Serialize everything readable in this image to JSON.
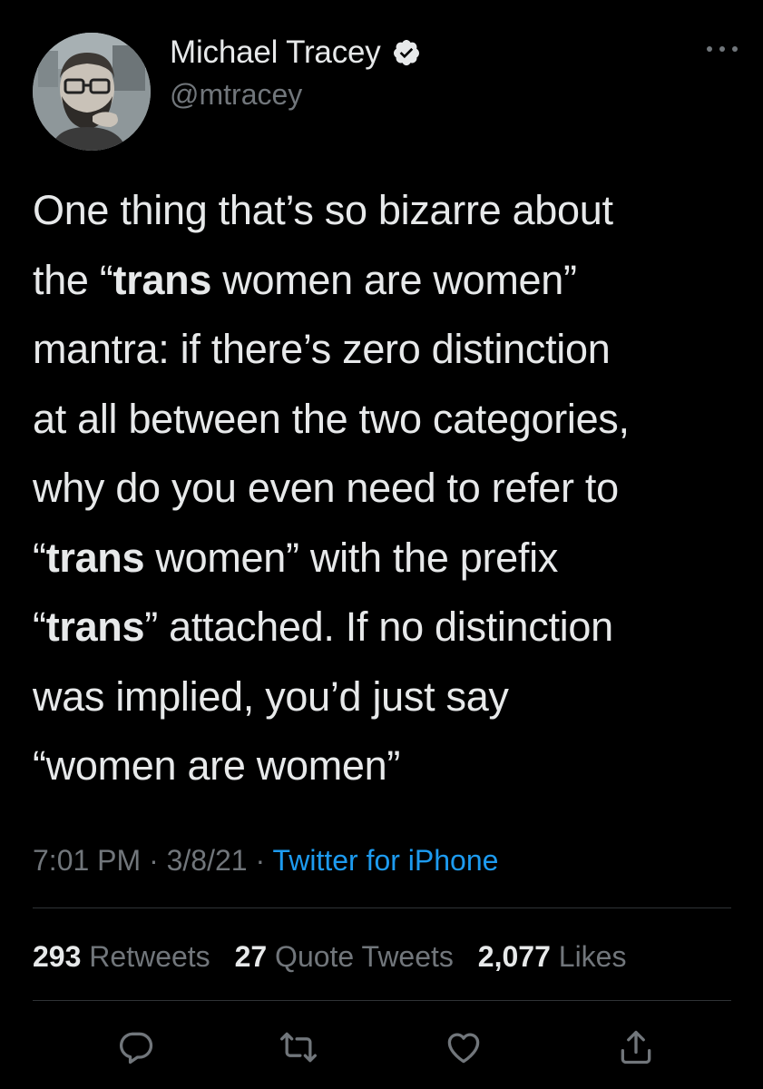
{
  "author": {
    "display_name": "Michael Tracey",
    "handle": "@mtracey",
    "verified": true
  },
  "tweet": {
    "text_segments": [
      [
        "One thing that’s so bizarre about"
      ],
      [
        "the “",
        {
          "b": "trans"
        },
        " women are women”"
      ],
      [
        "mantra: if there’s zero distinction"
      ],
      [
        "at all between the two categories,"
      ],
      [
        "why do you even need to refer to"
      ],
      [
        "“",
        {
          "b": "trans"
        },
        " women” with the prefix"
      ],
      [
        "“",
        {
          "b": "trans"
        },
        "” attached. If no distinction"
      ],
      [
        "was implied, you’d just say"
      ],
      [
        "“women are women”"
      ]
    ],
    "time": "7:01 PM",
    "date": "3/8/21",
    "separator": "·",
    "source": "Twitter for iPhone"
  },
  "stats": {
    "retweets_count": "293",
    "retweets_label": "Retweets",
    "quotes_count": "27",
    "quotes_label": "Quote Tweets",
    "likes_count": "2,077",
    "likes_label": "Likes"
  },
  "icons": {
    "reply": "reply-icon",
    "retweet": "retweet-icon",
    "like": "heart-icon",
    "share": "share-icon",
    "more": "more-icon",
    "verified": "verified-badge-icon"
  },
  "colors": {
    "background": "#000000",
    "text": "#e7e9ea",
    "secondary": "#71767b",
    "link": "#1d9bf0",
    "divider": "#2f3336"
  }
}
